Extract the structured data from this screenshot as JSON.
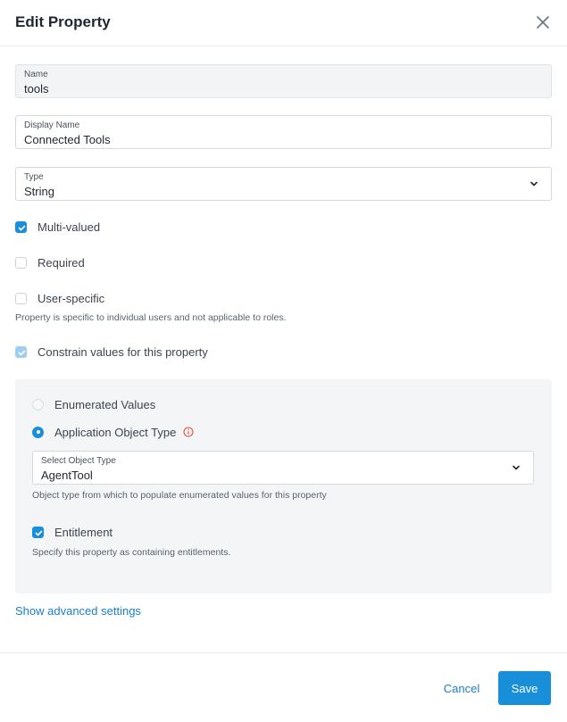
{
  "dialog": {
    "title": "Edit Property"
  },
  "fields": {
    "name": {
      "label": "Name",
      "value": "tools"
    },
    "display_name": {
      "label": "Display Name",
      "value": "Connected Tools"
    },
    "type": {
      "label": "Type",
      "value": "String"
    }
  },
  "options": {
    "multi_valued": {
      "label": "Multi-valued",
      "checked": true
    },
    "required": {
      "label": "Required",
      "checked": false
    },
    "user_specific": {
      "label": "User-specific",
      "checked": false,
      "help": "Property is specific to individual users and not applicable to roles."
    },
    "constrain": {
      "label": "Constrain values for this property",
      "checked": true
    }
  },
  "constraint_panel": {
    "enumerated": {
      "label": "Enumerated Values",
      "selected": false
    },
    "app_object_type": {
      "label": "Application Object Type",
      "selected": true
    },
    "object_type_select": {
      "label": "Select Object Type",
      "value": "AgentTool",
      "help": "Object type from which to populate enumerated values for this property"
    },
    "entitlement": {
      "label": "Entitlement",
      "checked": true,
      "help": "Specify this property as containing entitlements."
    }
  },
  "advanced_link": "Show advanced settings",
  "footer": {
    "cancel_label": "Cancel",
    "save_label": "Save"
  },
  "colors": {
    "accent": "#1a8fd9",
    "link": "#1a7fcc",
    "info_icon": "#e0533a",
    "panel_bg": "#f4f5f7"
  },
  "icons": {
    "close": "close-icon",
    "chevron": "chevron-down-icon",
    "check": "check-icon",
    "info": "info-icon"
  }
}
